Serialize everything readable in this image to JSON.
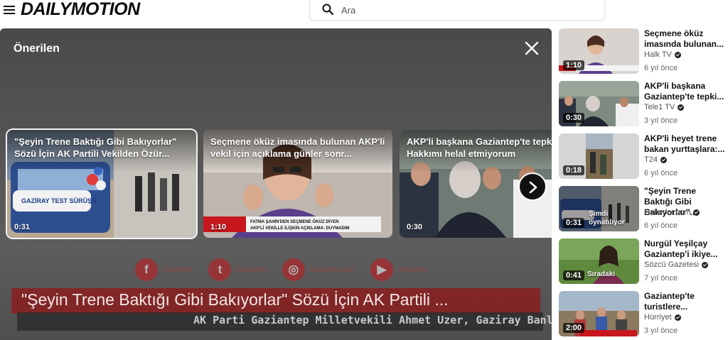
{
  "header": {
    "logo": "DAILYMOTION",
    "search_placeholder": "Ara"
  },
  "player": {
    "overlay_title": "\"Şeyin Trene Baktığı Gibi Bakıyorlar\" Sözü İçin AK Partili ...",
    "overlay_subtitle": "AK Parti Gaziantep Milletvekili Ahmet Uzer, Gaziray Banliyö h",
    "social": [
      {
        "glyph": "f",
        "handle": "/haberler"
      },
      {
        "glyph": "t",
        "handle": "/haberler"
      },
      {
        "glyph": "◎",
        "handle": "/haberlercom"
      },
      {
        "glyph": "▶",
        "handle": "/haberler"
      }
    ],
    "recommendations": {
      "heading": "Önerilen",
      "cards": [
        {
          "title": "\"Şeyin Trene Baktığı Gibi Bakıyorlar\" Sözü İçin AK Partili Vekilden Özür...",
          "duration": "0:31"
        },
        {
          "title": "Seçmene öküz imasında bulunan AKP'li vekil için açıklama günler sonr...",
          "duration": "1:10"
        },
        {
          "title": "AKP'li başkana Gaziantep'te tepki: Hakkımı helal etmiyorum",
          "duration": "0:30"
        }
      ]
    },
    "thumb_text": {
      "banner_line": "GAZİRAY TEST SÜRÜŞÜ",
      "news_ticker_1": "FATMA ŞAHİN'DEN SEÇMENE ÖKÜZ DİYEN",
      "news_ticker_2": "AKP'Lİ VEKİLLE İLİŞKİN AÇIKLAMA: DUYMADIM"
    }
  },
  "sidebar": {
    "items": [
      {
        "title": "Seçmene öküz imasında bulunan...",
        "channel": "Halk TV",
        "age": "6 yıl önce",
        "duration": "1:10",
        "badge": ""
      },
      {
        "title": "AKP'li başkana Gaziantep'te tepki...",
        "channel": "Tele1 TV",
        "age": "3 yıl önce",
        "duration": "0:30",
        "badge": ""
      },
      {
        "title": "AKP'li heyet trene bakan yurttaşlara:...",
        "channel": "T24",
        "age": "6 yıl önce",
        "duration": "0:18",
        "badge": ""
      },
      {
        "title": "\"Şeyin Trene Baktığı Gibi Bakıyorlar\"...",
        "channel": "Haberler.com",
        "age": "6 yıl önce",
        "duration": "0:31",
        "badge": "Şimdi oynatılıyor"
      },
      {
        "title": "Nurgül Yeşilçay Gaziantep'i ikiye...",
        "channel": "Sözcü Gazetesi",
        "age": "7 yıl önce",
        "duration": "0:41",
        "badge": "Sıradaki"
      },
      {
        "title": "Gaziantep'te turistlere...",
        "channel": "Hürriyet",
        "age": "3 yıl önce",
        "duration": "2:00",
        "badge": ""
      }
    ]
  }
}
